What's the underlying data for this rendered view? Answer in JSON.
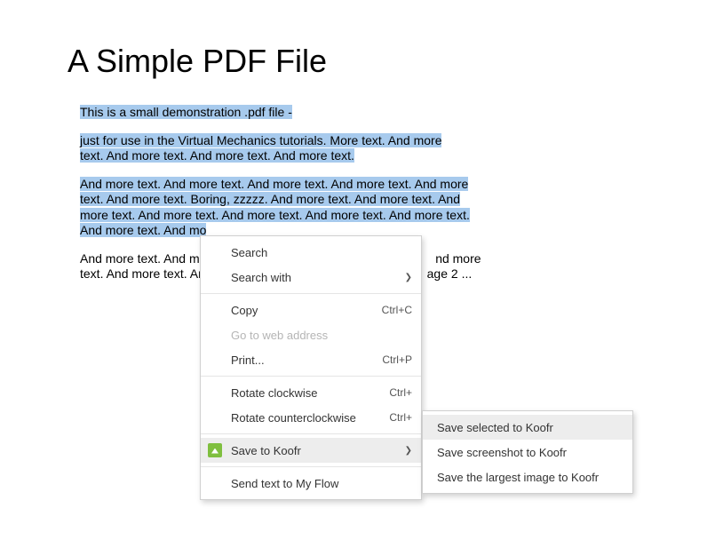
{
  "title": "A Simple PDF File",
  "para1": "This is a small demonstration .pdf file -",
  "para2a": "just for use in the Virtual Mechanics tutorials. More text. And more",
  "para2b": "text. And more text. And more text. And more text.",
  "para3a": "And more text. And more text. And more text. And more text. And more",
  "para3b": "text. And more text. Boring, zzzzz. And more text. And more text. And",
  "para3c": "more text. And more text. And more text. And more text. And more text.",
  "para3d": "And more text. And mo",
  "para4a_pre": "And more text. And mo",
  "para4a_post": "nd more",
  "para4b_pre": "text. And more text. An",
  "para4b_post": "age 2 ...",
  "menu": {
    "search": "Search",
    "search_with": "Search with",
    "copy": "Copy",
    "copy_sc": "Ctrl+C",
    "go_web": "Go to web address",
    "print": "Print...",
    "print_sc": "Ctrl+P",
    "rotate_cw": "Rotate clockwise",
    "rotate_cw_sc": "Ctrl+",
    "rotate_ccw": "Rotate counterclockwise",
    "rotate_ccw_sc": "Ctrl+",
    "save_koofr": "Save to Koofr",
    "send_flow": "Send text to My Flow"
  },
  "submenu": {
    "save_selected": "Save selected to Koofr",
    "save_screenshot": "Save screenshot to Koofr",
    "save_largest": "Save the largest image to Koofr"
  }
}
